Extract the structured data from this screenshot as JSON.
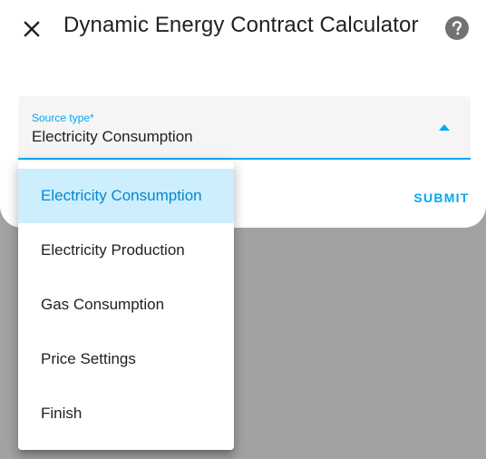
{
  "dialog": {
    "title": "Dynamic Energy Contract Calculator",
    "close_icon": "close-icon",
    "help_icon": "help-circle-icon"
  },
  "source_select": {
    "label": "Source type*",
    "value": "Electricity Consumption",
    "arrow_icon": "menu-up-icon"
  },
  "actions": {
    "submit_label": "SUBMIT"
  },
  "menu": {
    "selected_index": 0,
    "items": [
      {
        "label": "Electricity Consumption"
      },
      {
        "label": "Electricity Production"
      },
      {
        "label": "Gas Consumption"
      },
      {
        "label": "Price Settings"
      },
      {
        "label": "Finish"
      }
    ]
  },
  "colors": {
    "accent": "#03a9f4",
    "selected_bg": "#cdeefd",
    "scrim": "#a2a2a2",
    "field_bg": "#f5f5f5"
  }
}
